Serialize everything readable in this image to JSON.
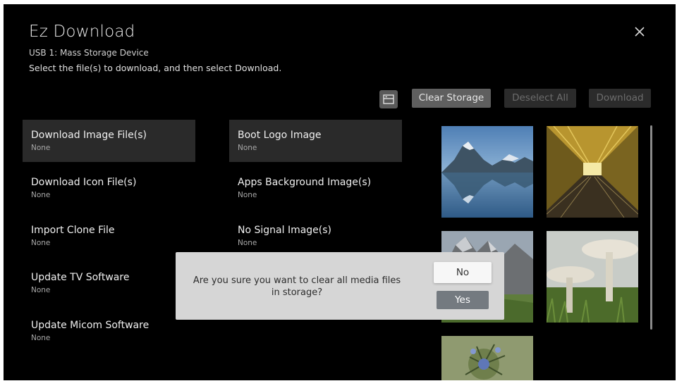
{
  "header": {
    "title": "Ez Download",
    "device": "USB 1: Mass Storage Device",
    "instruction": "Select the file(s) to download, and then select Download.",
    "close_icon": "close-icon"
  },
  "toolbar": {
    "view_icon": "list-view-icon",
    "clear_storage": "Clear Storage",
    "deselect_all": "Deselect All",
    "download": "Download",
    "enabled_color": "#5f5f5f",
    "disabled_color": "#2b2b2b"
  },
  "left_menu": [
    {
      "label": "Download Image File(s)",
      "value": "None",
      "selected": true
    },
    {
      "label": "Download Icon File(s)",
      "value": "None"
    },
    {
      "label": "Import Clone File",
      "value": "None"
    },
    {
      "label": "Update TV Software",
      "value": "None"
    },
    {
      "label": "Update Micom Software",
      "value": "None"
    }
  ],
  "right_menu": [
    {
      "label": "Boot Logo Image",
      "value": "None",
      "selected": true
    },
    {
      "label": "Apps Background Image(s)",
      "value": "None"
    },
    {
      "label": "No Signal Image(s)",
      "value": "None"
    }
  ],
  "thumbnails": [
    {
      "subject": "mountain-lake"
    },
    {
      "subject": "golden-tunnel"
    },
    {
      "subject": "rocky-mountains"
    },
    {
      "subject": "mushrooms"
    },
    {
      "subject": "blue-flower"
    }
  ],
  "dialog": {
    "message": "Are you sure you want to clear all media files in storage?",
    "no": "No",
    "yes": "Yes"
  }
}
